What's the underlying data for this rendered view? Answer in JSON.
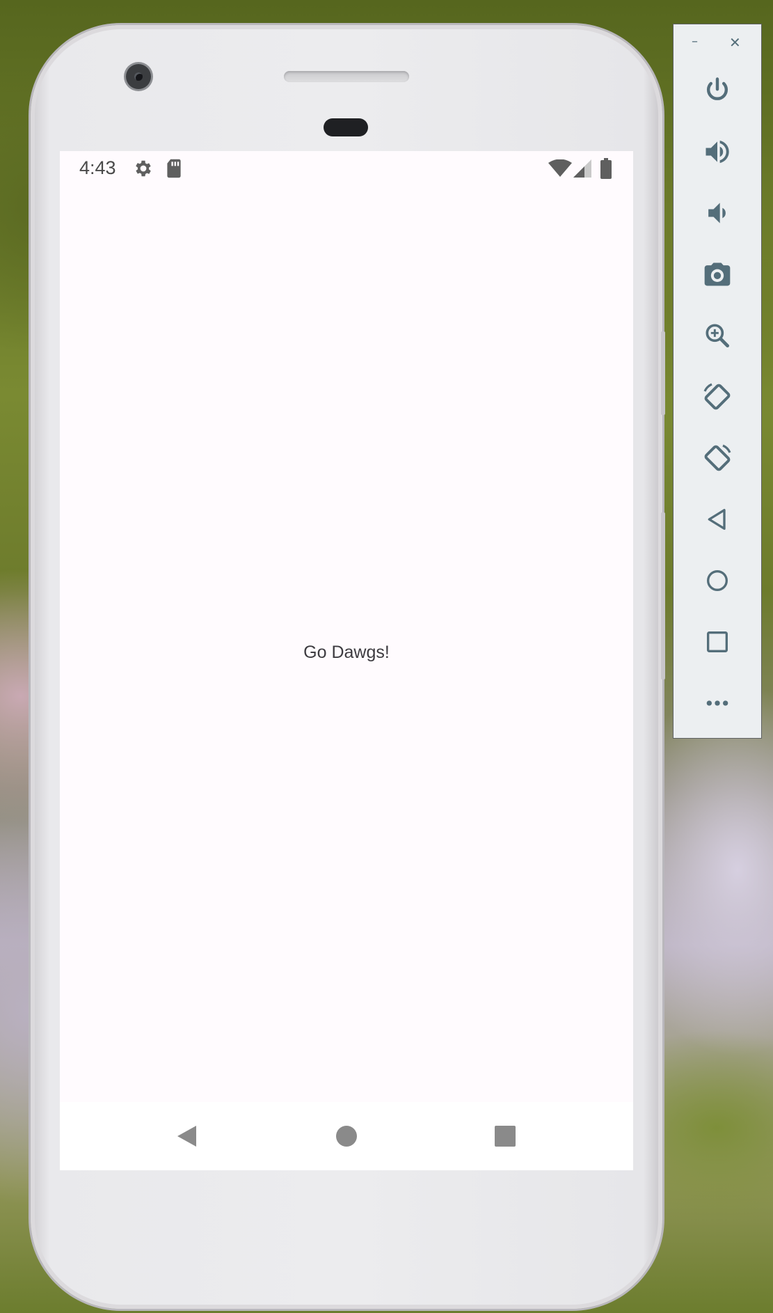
{
  "status_bar": {
    "time": "4:43",
    "left_icons": [
      "settings-icon",
      "sd-card-icon"
    ],
    "right_icons": [
      "wifi-icon",
      "cellular-signal-icon",
      "battery-icon"
    ]
  },
  "app": {
    "center_text": "Go Dawgs!"
  },
  "nav_bar": {
    "buttons": [
      "back",
      "home",
      "recents"
    ]
  },
  "emulator_panel": {
    "window_controls": {
      "minimize": "–",
      "close": "✕"
    },
    "tools": [
      "power",
      "volume-up",
      "volume-down",
      "screenshot",
      "zoom",
      "rotate-left",
      "rotate-right",
      "back",
      "home",
      "overview",
      "more"
    ]
  },
  "colors": {
    "panel_icon": "#546e7a",
    "screen_bg": "#fffbfe",
    "status_icons": "#5f5f5f",
    "nav_icons": "#8a8a8a"
  }
}
